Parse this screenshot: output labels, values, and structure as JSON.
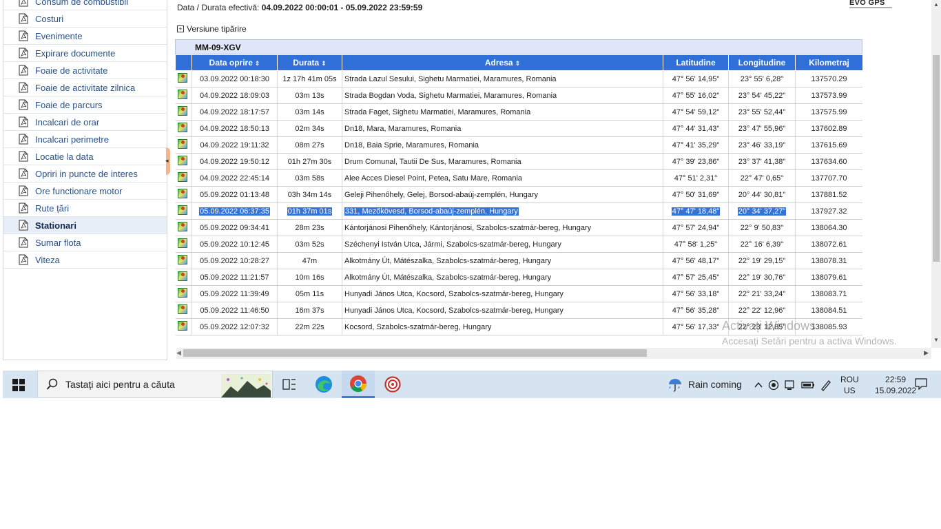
{
  "sidebar": {
    "items": [
      {
        "label": "Consum de combustibil",
        "active": false
      },
      {
        "label": "Costuri",
        "active": false
      },
      {
        "label": "Evenimente",
        "active": false
      },
      {
        "label": "Expirare documente",
        "active": false
      },
      {
        "label": "Foaie de activitate",
        "active": false
      },
      {
        "label": "Foaie de activitate zilnica",
        "active": false
      },
      {
        "label": "Foaie de parcurs",
        "active": false
      },
      {
        "label": "Incalcari de orar",
        "active": false
      },
      {
        "label": "Incalcari perimetre",
        "active": false
      },
      {
        "label": "Locatie la data",
        "active": false
      },
      {
        "label": "Opriri in puncte de interes",
        "active": false
      },
      {
        "label": "Ore functionare motor",
        "active": false
      },
      {
        "label": "Rute țări",
        "active": false
      },
      {
        "label": "Stationari",
        "active": true
      },
      {
        "label": "Sumar flota",
        "active": false
      },
      {
        "label": "Viteza",
        "active": false
      }
    ]
  },
  "report": {
    "period_label": "Data / Durata efectivă:",
    "period_value": "04.09.2022 00:00:01 - 05.09.2022 23:59:59",
    "logo": "EVO GPS",
    "print_label": "Versiune tipărire",
    "vehicle": "MM-09-XGV"
  },
  "table": {
    "columns": [
      "",
      "Data oprire",
      "Durata",
      "Adresa",
      "Latitudine",
      "Longitudine",
      "Kilometraj"
    ],
    "rows": [
      {
        "date": "03.09.2022 00:18:30",
        "duration": "1z 17h 41m 05s",
        "address": "Strada Lazul Sesului,    Sighetu Marmatiei, Maramures, Romania",
        "lat": "47° 56' 14,95\"",
        "lon": "23° 55' 6,28\"",
        "km": "137570.29"
      },
      {
        "date": "04.09.2022 18:09:03",
        "duration": "03m 13s",
        "address": "Strada Bogdan Voda,    Sighetu Marmatiei, Maramures, Romania",
        "lat": "47° 55' 16,02\"",
        "lon": "23° 54' 45,22\"",
        "km": "137573.99"
      },
      {
        "date": "04.09.2022 18:17:57",
        "duration": "03m 14s",
        "address": "Strada Faget,    Sighetu Marmatiei, Maramures, Romania",
        "lat": "47° 54' 59,12\"",
        "lon": "23° 55' 52,44\"",
        "km": "137575.99"
      },
      {
        "date": "04.09.2022 18:50:13",
        "duration": "02m 34s",
        "address": "Dn18,    Mara, Maramures, Romania",
        "lat": "47° 44' 31,43\"",
        "lon": "23° 47' 55,96\"",
        "km": "137602.89"
      },
      {
        "date": "04.09.2022 19:11:32",
        "duration": "08m 27s",
        "address": "Dn18,    Baia Sprie, Maramures, Romania",
        "lat": "47° 41' 35,29\"",
        "lon": "23° 46' 33,19\"",
        "km": "137615.69"
      },
      {
        "date": "04.09.2022 19:50:12",
        "duration": "01h 27m 30s",
        "address": "Drum Comunal,    Tautii De Sus, Maramures, Romania",
        "lat": "47° 39' 23,86\"",
        "lon": "23° 37' 41,38\"",
        "km": "137634.60"
      },
      {
        "date": "04.09.2022 22:45:14",
        "duration": "03m 58s",
        "address": "Alee Acces Diesel Point,    Petea, Satu Mare, Romania",
        "lat": "47° 51' 2,31\"",
        "lon": "22° 47' 0,65\"",
        "km": "137707.70"
      },
      {
        "date": "05.09.2022 01:13:48",
        "duration": "03h 34m 14s",
        "address": "Geleji Pihenőhely,    Gelej, Borsod-abaúj-zemplén, Hungary",
        "lat": "47° 50' 31,69\"",
        "lon": "20° 44' 30,81\"",
        "km": "137881.52"
      },
      {
        "date": "05.09.2022 06:37:35",
        "duration": "01h 37m 01s",
        "address": "331,    Mezőkövesd, Borsod-abaúj-zemplén, Hungary",
        "lat": "47° 47' 18,48\"",
        "lon": "20° 34' 37,27\"",
        "km": "137927.32",
        "selected": true
      },
      {
        "date": "05.09.2022 09:34:41",
        "duration": "28m 23s",
        "address": "Kántorjánosi Pihenőhely,    Kántorjánosi, Szabolcs-szatmár-bereg, Hungary",
        "lat": "47° 57' 24,94\"",
        "lon": "22° 9' 50,83\"",
        "km": "138064.30"
      },
      {
        "date": "05.09.2022 10:12:45",
        "duration": "03m 52s",
        "address": "Széchenyi István Utca,    Jármi, Szabolcs-szatmár-bereg, Hungary",
        "lat": "47° 58' 1,25\"",
        "lon": "22° 16' 6,39\"",
        "km": "138072.61"
      },
      {
        "date": "05.09.2022 10:28:27",
        "duration": "47m",
        "address": "Alkotmány Út,    Mátészalka, Szabolcs-szatmár-bereg, Hungary",
        "lat": "47° 56' 48,17\"",
        "lon": "22° 19' 29,15\"",
        "km": "138078.31"
      },
      {
        "date": "05.09.2022 11:21:57",
        "duration": "10m 16s",
        "address": "Alkotmány Út,    Mátészalka, Szabolcs-szatmár-bereg, Hungary",
        "lat": "47° 57' 25,45\"",
        "lon": "22° 19' 30,76\"",
        "km": "138079.61"
      },
      {
        "date": "05.09.2022 11:39:49",
        "duration": "05m 11s",
        "address": "Hunyadi János Utca,    Kocsord, Szabolcs-szatmár-bereg, Hungary",
        "lat": "47° 56' 33,18\"",
        "lon": "22° 21' 33,24\"",
        "km": "138083.71"
      },
      {
        "date": "05.09.2022 11:46:50",
        "duration": "16m 37s",
        "address": "Hunyadi János Utca,    Kocsord, Szabolcs-szatmár-bereg, Hungary",
        "lat": "47° 56' 35,28\"",
        "lon": "22° 22' 12,96\"",
        "km": "138084.51"
      },
      {
        "date": "05.09.2022 12:07:32",
        "duration": "22m 22s",
        "address": "Kocsord, Szabolcs-szatmár-bereg, Hungary",
        "lat": "47° 56' 17,33\"",
        "lon": "22° 23' 12,85\"",
        "km": "138085.93"
      }
    ]
  },
  "watermark": {
    "line1": "Activați Windows",
    "line2": "Accesați Setări pentru a activa Windows."
  },
  "taskbar": {
    "search_placeholder": "Tastați aici pentru a căuta",
    "weather": "Rain coming",
    "lang_top": "ROU",
    "lang_bottom": "US",
    "time": "22:59",
    "date": "15.09.2022",
    "apps": [
      "task-view",
      "edge",
      "chrome",
      "app-red"
    ]
  },
  "colors": {
    "header_blue": "#2f6fd8",
    "selection_blue": "#3375d6",
    "taskbar": "#d6e4f2"
  }
}
